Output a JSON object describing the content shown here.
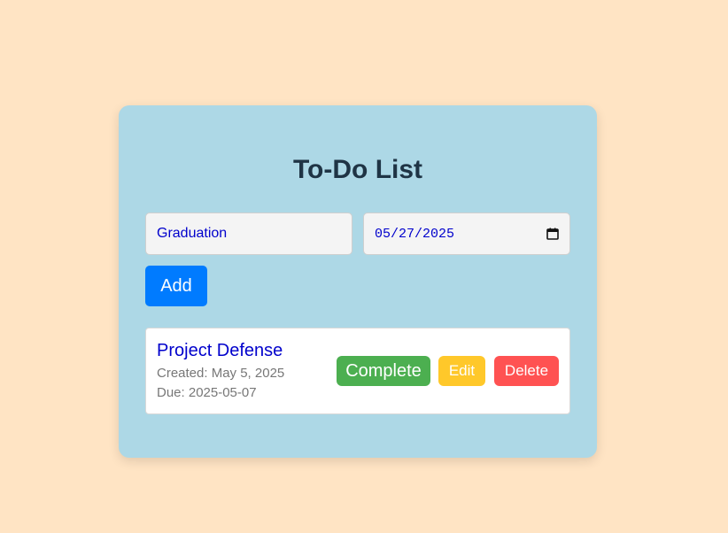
{
  "app": {
    "title": "To-Do List"
  },
  "form": {
    "task_value": "Graduation",
    "date_value": "05/27/2025",
    "add_label": "Add"
  },
  "todos": [
    {
      "title": "Project Defense",
      "created": "Created: May 5, 2025",
      "due": "Due: 2025-05-07",
      "complete_label": "Complete",
      "edit_label": "Edit",
      "delete_label": "Delete"
    }
  ],
  "icons": {
    "date_picker": "calendar-icon"
  },
  "colors": {
    "page_background": "#ffe4c4",
    "card_background": "#add8e6",
    "add_button": "#007bff",
    "complete_button": "#4caf50",
    "edit_button": "#ffc82a",
    "delete_button": "#ff5252",
    "task_text": "#0000cc"
  }
}
